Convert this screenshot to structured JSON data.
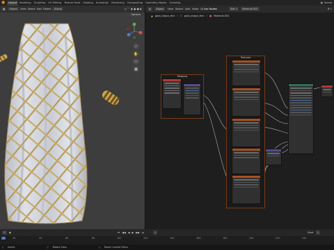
{
  "topbar": {
    "tabs": [
      "Layout",
      "Modeling",
      "Sculpting",
      "UV Editing",
      "Texture Paint",
      "Shading",
      "Animation",
      "Rendering",
      "Compositing",
      "Geometry Nodes",
      "Scripting"
    ],
    "active_tab": "Layout",
    "scene_label": "Scene"
  },
  "viewport": {
    "mode": "Object",
    "view": "View",
    "select": "Select",
    "add": "Add",
    "object_menu": "Object",
    "transform": "Global",
    "options": "Options"
  },
  "node_editor": {
    "editor_type": "Object",
    "view": "View",
    "select": "Select",
    "add": "Add",
    "node": "Node",
    "use_nodes": "Use Nodes",
    "slot": "Slot 1",
    "material": "Material.001",
    "breadcrumb": [
      "gold_drape_thin",
      "gold_drape_thin",
      "Material.001"
    ],
    "frames": [
      {
        "title": "Mapping"
      },
      {
        "title": "Textures"
      }
    ]
  },
  "timeline": {
    "ticks": [
      "0",
      "20",
      "40",
      "60",
      "80",
      "100",
      "120",
      "140",
      "160",
      "180",
      "200",
      "220",
      "240"
    ],
    "start_label": "Start",
    "start_value": "1",
    "current_frame": "1"
  },
  "statusbar": {
    "items": [
      "Select",
      "Rotate View",
      "Reset Context Menu"
    ]
  },
  "colors": {
    "accent": "#e87d0d",
    "frame_border": "#7a3a18",
    "wire": "#cfcfcf",
    "selected_header": "#b85a1a",
    "bsdf_header": "#2f6f5a"
  }
}
